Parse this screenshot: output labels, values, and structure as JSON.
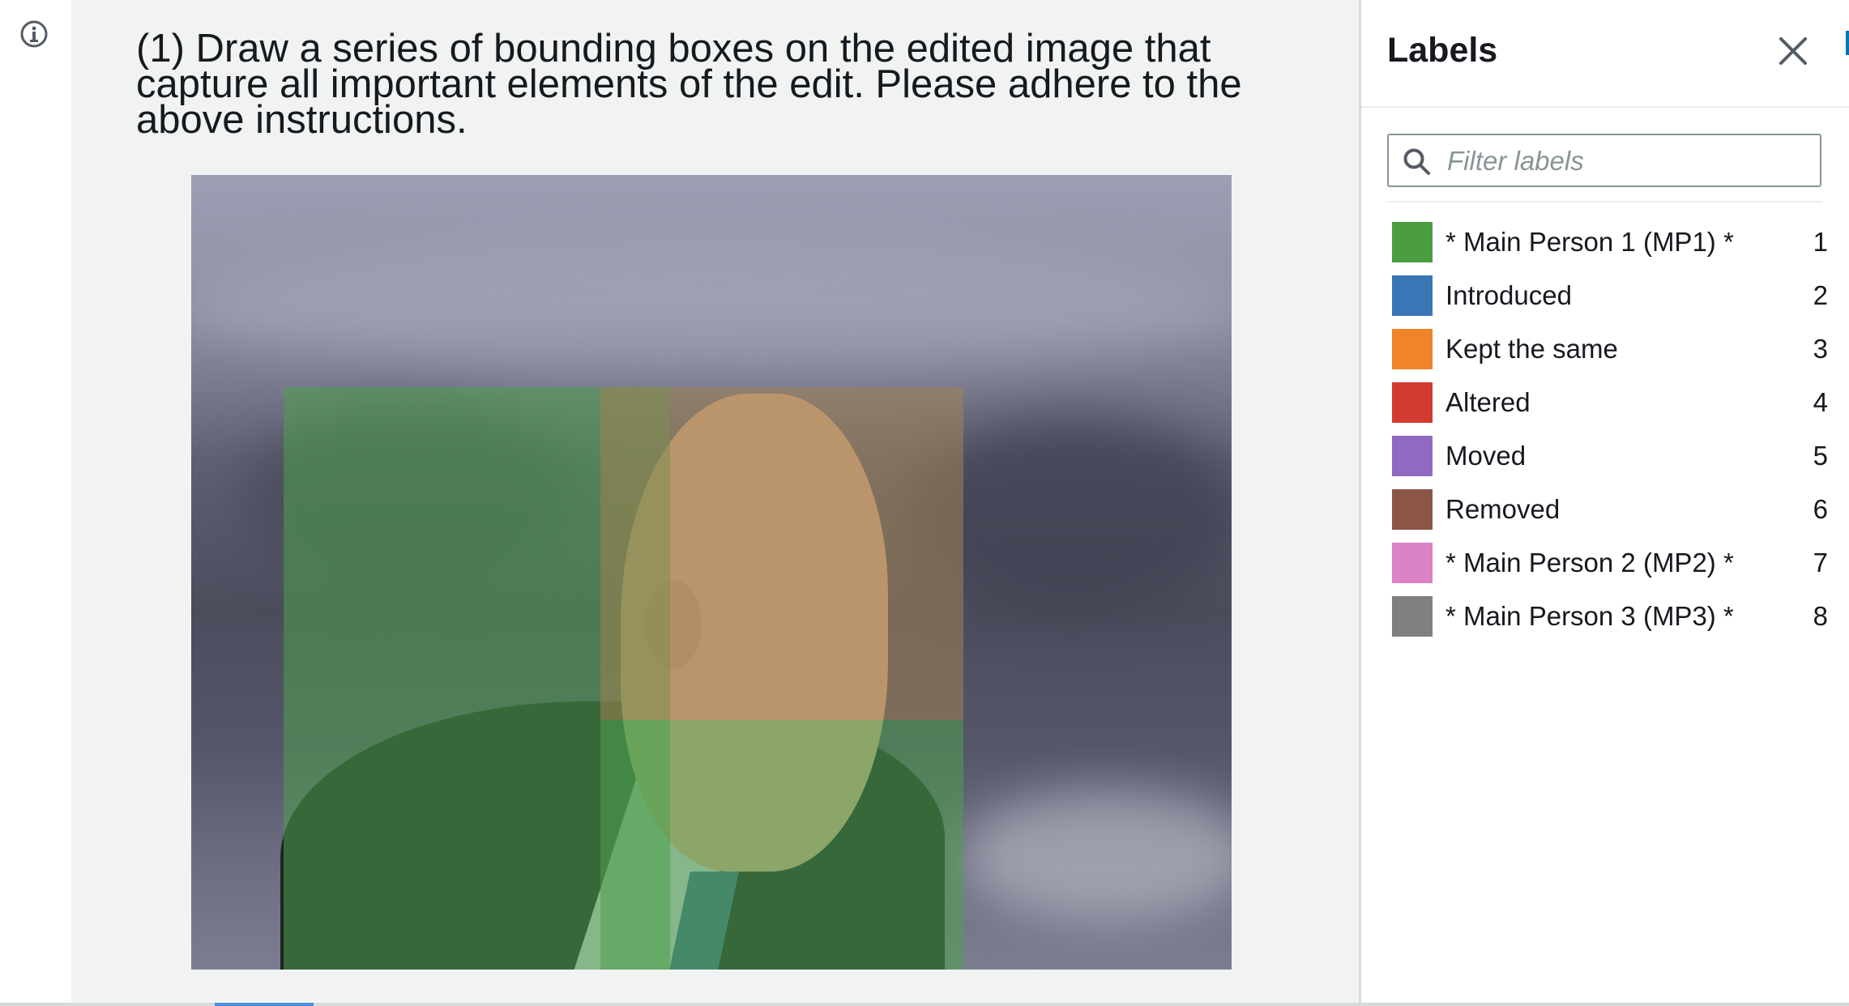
{
  "instruction": {
    "text": "(1) Draw a series of bounding boxes on the edited image that capture all important elements of the edit. Please adhere to the above instructions."
  },
  "panel": {
    "title": "Labels",
    "filter_placeholder": "Filter labels",
    "labels": [
      {
        "text": "* Main Person 1 (MP1) *",
        "key": "1",
        "color": "#4a9e3f"
      },
      {
        "text": "Introduced",
        "key": "2",
        "color": "#3a76b5"
      },
      {
        "text": "Kept the same",
        "key": "3",
        "color": "#f0842b"
      },
      {
        "text": "Altered",
        "key": "4",
        "color": "#d33a31"
      },
      {
        "text": "Moved",
        "key": "5",
        "color": "#9069c1"
      },
      {
        "text": "Removed",
        "key": "6",
        "color": "#8b5548"
      },
      {
        "text": "* Main Person 2 (MP2) *",
        "key": "7",
        "color": "#dc83c5"
      },
      {
        "text": "* Main Person 3 (MP3) *",
        "key": "8",
        "color": "#808080"
      }
    ]
  },
  "icons": {
    "info": "info-icon",
    "close": "close-icon",
    "search": "search-icon"
  }
}
